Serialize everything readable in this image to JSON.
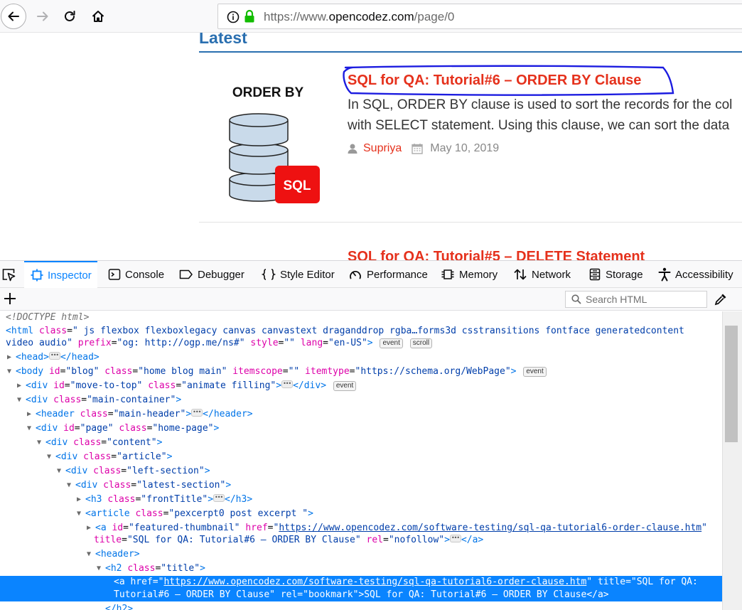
{
  "browser": {
    "url_prefix": "https://www.",
    "url_domain": "opencodez.com",
    "url_path": "/page/0"
  },
  "page": {
    "latest_heading": "Latest",
    "thumbnail_label": "ORDER BY",
    "thumbnail_badge": "SQL",
    "post1": {
      "title": "SQL for QA: Tutorial#6 – ORDER BY Clause",
      "excerpt_line1": "In SQL, ORDER BY clause is used to sort the records for the col",
      "excerpt_line2": "with SELECT statement. Using this clause, we can sort the data",
      "author": "Supriya",
      "date": "May 10, 2019"
    },
    "post2_title": "SQL for QA: Tutorial#5 – DELETE Statement"
  },
  "devtools": {
    "tabs": {
      "inspector": "Inspector",
      "console": "Console",
      "debugger": "Debugger",
      "style_editor": "Style Editor",
      "performance": "Performance",
      "memory": "Memory",
      "network": "Network",
      "storage": "Storage",
      "accessibility": "Accessibility"
    },
    "search_placeholder": "Search HTML",
    "badges": {
      "event": "event",
      "scroll": "scroll"
    },
    "markup": {
      "doctype": "<!DOCTYPE html>",
      "html_class": "\" js flexbox flexboxlegacy canvas canvastext draganddrop rgba…forms3d csstransitions fontface generatedcontent",
      "html_class_cont": "video audio\"",
      "html_prefix": "\"og: http://ogp.me/ns#\"",
      "html_style": "\"\"",
      "html_lang": "\"en-US\"",
      "body_id": "\"blog\"",
      "body_class": "\"home blog main\"",
      "body_itemscope": "\"\"",
      "body_itemtype": "\"https://schema.org/WebPage\"",
      "move_to_top_id": "\"move-to-top\"",
      "move_to_top_class": "\"animate filling\"",
      "main_container_class": "\"main-container\"",
      "header_class": "\"main-header\"",
      "page_id": "\"page\"",
      "page_class": "\"home-page\"",
      "content_class": "\"content\"",
      "article_div_class": "\"article\"",
      "left_section_class": "\"left-section\"",
      "latest_section_class": "\"latest-section\"",
      "front_title_class": "\"frontTitle\"",
      "article_class": "\"pexcerpt0 post excerpt \"",
      "thumb_id": "\"featured-thumbnail\"",
      "thumb_href": "https://www.opencodez.com/software-testing/sql-qa-tutorial6-order-clause.htm",
      "thumb_title": "\"SQL for QA: Tutorial#6 – ORDER BY Clause\"",
      "thumb_rel": "\"nofollow\"",
      "h2_class": "\"title\"",
      "link_href": "https://www.opencodez.com/software-testing/sql-qa-tutorial6-order-clause.htm",
      "link_title_a": "\"SQL for QA:",
      "link_title_b": "Tutorial#6 – ORDER BY Clause\"",
      "link_rel": "\"bookmark\"",
      "link_text": "SQL for QA: Tutorial#6 – ORDER BY Clause"
    }
  }
}
